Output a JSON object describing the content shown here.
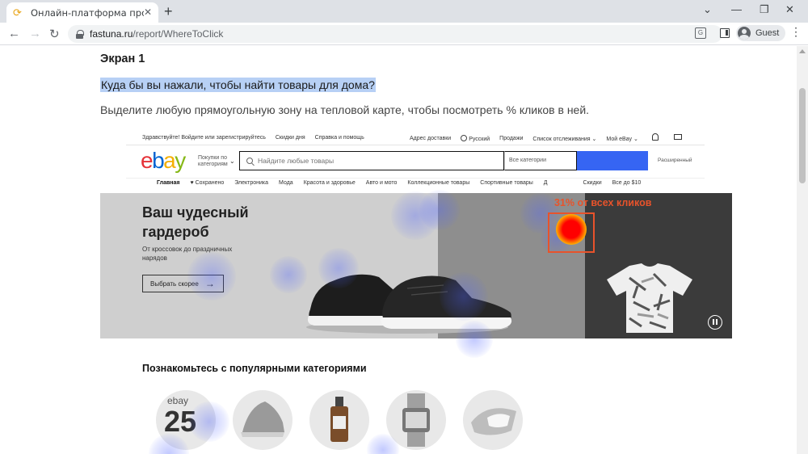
{
  "browser": {
    "tab_title": "Онлайн-платформа проверки д",
    "url_host": "fastuna.ru",
    "url_path": "/report/WhereToClick",
    "profile_name": "Guest"
  },
  "page": {
    "screen_title": "Экран 1",
    "question": "Куда бы вы нажали, чтобы найти товары для дома?",
    "instruction": "Выделите любую прямоугольную зону на тепловой карте, чтобы посмотреть % кликов в ней."
  },
  "heatmap": {
    "selection_label": "31% от всех кликов",
    "selection_value_percent": 31,
    "hot_color": "#ff0000",
    "selection_color": "#e8532b"
  },
  "ebay": {
    "top_nav_left": [
      "Здравствуйте! Войдите или зарегистрируйтесь",
      "Скидки дня",
      "Справка и помощь"
    ],
    "top_nav_right": [
      "Адрес доставки",
      "Русский",
      "Продажи",
      "Список отслеживания ⌄",
      "Мой eBay ⌄"
    ],
    "logo": {
      "e": "e",
      "b": "b",
      "a": "a",
      "y": "y"
    },
    "shop_by": "Покупки по категориям",
    "search_placeholder": "Найдите любые товары",
    "search_category": "Все категории",
    "advanced": "Расширенный",
    "category_nav": [
      "Главная",
      "♥ Сохранено",
      "Электроника",
      "Мода",
      "Красота и здоровье",
      "Авто и мото",
      "Коллекционные товары",
      "Спортивные товары",
      "Д",
      "",
      "Скидки",
      "Все до $10"
    ],
    "hero": {
      "title": "Ваш чудесный гардероб",
      "subtitle": "От кроссовок до праздничных нарядов",
      "button": "Выбрать скорее"
    },
    "popular_title": "Познакомьтесь с популярными категориями",
    "badge_brand": "ebay",
    "badge_number": "25"
  }
}
